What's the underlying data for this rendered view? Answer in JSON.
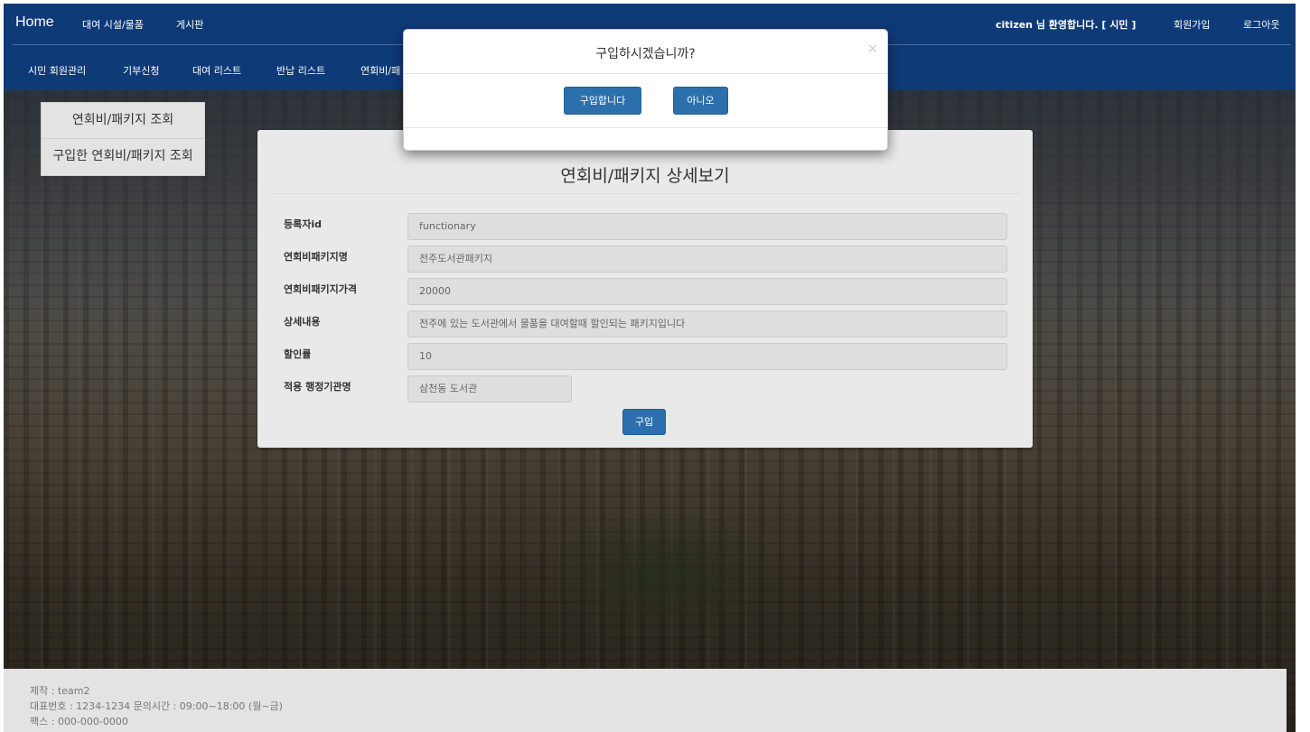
{
  "navbar": {
    "brand": "Home",
    "top_links": [
      "대여 시설/물품",
      "게시판"
    ],
    "welcome": "citizen 님 환영합니다. [ 시민 ]",
    "signup": "회원가입",
    "logout": "로그아웃",
    "sub_links": [
      "시민 회원관리",
      "기부신청",
      "대여 리스트",
      "반납 리스트",
      "연회비/패"
    ]
  },
  "side_menu": {
    "items": [
      "연회비/패키지 조회",
      "구입한 연회비/패키지 조회"
    ]
  },
  "panel": {
    "title": "연회비/패키지 상세보기",
    "fields": [
      {
        "label": "등록자id",
        "value": "functionary"
      },
      {
        "label": "연회비패키지명",
        "value": "전주도서관패키지"
      },
      {
        "label": "연회비패키지가격",
        "value": "20000"
      },
      {
        "label": "상세내용",
        "value": "전주에 있는 도서관에서 물품을 대여할때 할인되는 패키지입니다"
      },
      {
        "label": "할인률",
        "value": "10"
      },
      {
        "label": "적용 행정기관명",
        "value": "삼천동 도서관"
      }
    ],
    "buy_label": "구입"
  },
  "modal": {
    "title": "구입하시겠습니까?",
    "close_glyph": "×",
    "confirm_label": "구입합니다",
    "cancel_label": "아니오"
  },
  "footer": {
    "maker": "제작 : team2",
    "phone": "대표번호 : 1234-1234 문의시간 : 09:00~18:00 (월~금)",
    "fax": "팩스 : 000-000-0000"
  },
  "colors": {
    "navbar": "#0f3a78",
    "primary_button": "#2c6fad",
    "panel": "#e9e9e9"
  }
}
